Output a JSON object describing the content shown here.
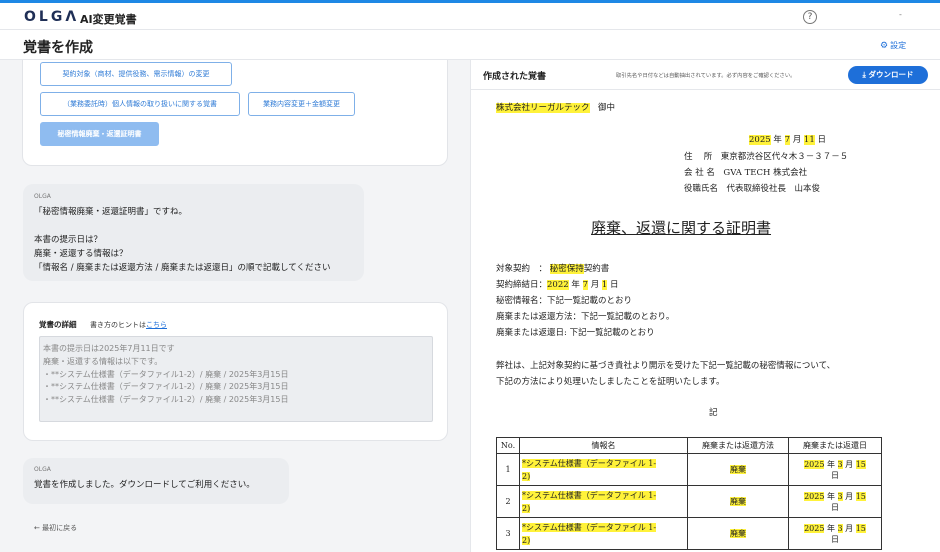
{
  "header": {
    "logo": "OLGΛ",
    "app_name": "AI変更覚書",
    "help_icon": "?",
    "user_menu": "-"
  },
  "page": {
    "title": "覚書を作成",
    "settings_label": "設定"
  },
  "chat": {
    "choices": [
      "契約対象（商材、提供役務、需示情報）の変更",
      "（業務委託時）個人情報の取り扱いに関する覚書",
      "業務内容変更＋金額変更",
      "秘密情報廃棄・返還証明書"
    ],
    "selected_choice_index": 3,
    "olga_question": {
      "sender": "OLGA",
      "text": "「秘密情報廃棄・返還証明書」ですね。\n\n本書の提示日は？\n廃棄・返還する情報は？\n「情報名 / 廃棄または返還方法 / 廃棄または返還日」の順で記載してください"
    },
    "details": {
      "title": "覚書の詳細",
      "hint_prefix": "書き方のヒントは",
      "hint_link": "こちら",
      "content": "本書の提示日は2025年7月11日です\n廃棄・返還する情報は以下です。\n・**システム仕様書（データファイル1-2）/ 廃棄 / 2025年3月15日\n・**システム仕様書（データファイル1-2）/ 廃棄 / 2025年3月15日\n・**システム仕様書（データファイル1-2）/ 廃棄 / 2025年3月15日"
    },
    "olga_done": {
      "sender": "OLGA",
      "text": "覚書を作成しました。ダウンロードしてご利用ください。"
    },
    "back_label": "← 最初に戻る"
  },
  "document_panel": {
    "title": "作成された覚書",
    "note": "取引先名や日付などは自動抽出されています。必ず内容をご確認ください。",
    "download_label": "ダウンロード",
    "download_icon": "⤓"
  },
  "document": {
    "addressee": "株式会社リーガルテック",
    "addressee_suffix": "御中",
    "date_year": "2025",
    "date_month": "7",
    "date_day": "11",
    "date_unit_year": "年",
    "date_unit_month": "月",
    "date_unit_day": "日",
    "address_label": "住　 所",
    "address": "東京都渋谷区代々木３－３７－５",
    "company_label": "会 社 名",
    "company": "GVA TECH 株式会社",
    "officer_label": "役職氏名",
    "officer": "代表取締役社長　山本俊",
    "title": "廃棄、返還に関する証明書",
    "contract_label": "対象契約　：",
    "contract_hl": "秘密保持",
    "contract_rest": "契約書",
    "signed_label": "契約締結日：",
    "signed_year": "2022",
    "signed_month": "7",
    "signed_day": "1",
    "info_line": "秘密情報名：下記一覧記載のとおり",
    "method_line": "廃棄または返還方法：下記一覧記載のとおり。",
    "date_line": "廃棄または返還日: 下記一覧記載のとおり",
    "body_line1": "弊社は、上記対象契約に基づき貴社より開示を受けた下記一覧記載の秘密情報について、",
    "body_line2": "下記の方法により処理いたしましたことを証明いたします。",
    "ki": "記",
    "table": {
      "headers": [
        "No.",
        "情報名",
        "廃棄または返還方法",
        "廃棄または返還日"
      ],
      "rows": [
        {
          "no": "1",
          "info_a": "*システム仕様書（データファイル 1-",
          "info_b": "2)",
          "method": "廃棄",
          "year": "2025",
          "month": "3",
          "day": "15",
          "day_unit": "日"
        },
        {
          "no": "2",
          "info_a": "*システム仕様書（データファイル 1-",
          "info_b": "2)",
          "method": "廃棄",
          "year": "2025",
          "month": "3",
          "day": "15",
          "day_unit": "日"
        },
        {
          "no": "3",
          "info_a": "*システム仕様書（データファイル 1-",
          "info_b": "2)",
          "method": "廃棄",
          "year": "2025",
          "month": "3",
          "day": "15",
          "day_unit": "日"
        }
      ]
    }
  },
  "colors": {
    "accent": "#1e6fd9",
    "highlight": "#fff23a",
    "chip_selected": "#8fbcf0"
  }
}
